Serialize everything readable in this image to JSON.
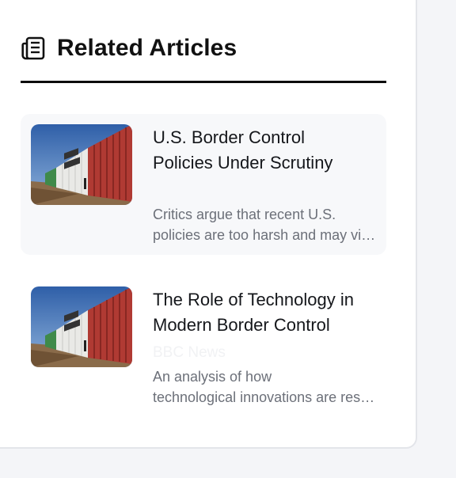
{
  "related": {
    "heading": "Related Articles",
    "articles": [
      {
        "title_line1": "U.S. Border Control",
        "title_line2": "Policies Under Scrutiny",
        "source": "",
        "summary_line1": "Critics argue that recent U.S.",
        "summary_line2": "policies are too harsh and may violate human rights."
      },
      {
        "title_line1": "The Role of Technology in",
        "title_line2": "Modern Border Control",
        "source": "BBC News",
        "summary_line1": "An analysis of how",
        "summary_line2": "technological innovations are reshaping border security."
      }
    ]
  },
  "colors": {
    "heading": "#111111",
    "card_active_bg": "#f7f8fa",
    "summary_text": "#6c7079"
  },
  "icons": {
    "heading_icon": "newspaper-icon"
  }
}
